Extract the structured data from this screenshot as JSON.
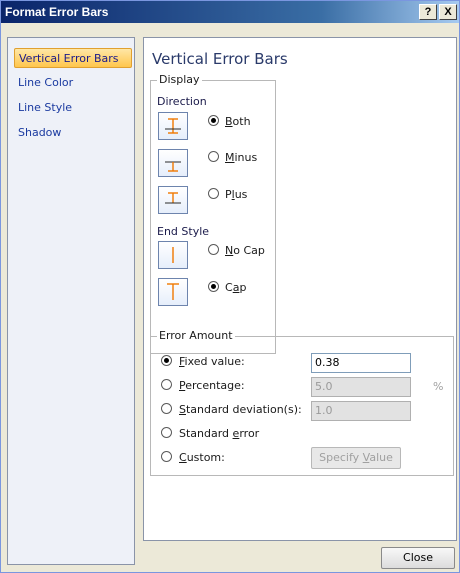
{
  "window": {
    "title": "Format Error Bars",
    "help_label": "?",
    "close_label": "X"
  },
  "nav": {
    "items": [
      {
        "label": "Vertical Error Bars",
        "active": true
      },
      {
        "label": "Line Color",
        "active": false
      },
      {
        "label": "Line Style",
        "active": false
      },
      {
        "label": "Shadow",
        "active": false
      }
    ]
  },
  "panel": {
    "title": "Vertical Error Bars",
    "display": {
      "legend": "Display",
      "direction_label": "Direction",
      "direction_options": [
        {
          "pre": "",
          "ul": "B",
          "post": "oth",
          "checked": true
        },
        {
          "pre": "",
          "ul": "M",
          "post": "inus",
          "checked": false
        },
        {
          "pre": "P",
          "ul": "l",
          "post": "us",
          "checked": false
        }
      ],
      "end_style_label": "End Style",
      "end_style_options": [
        {
          "pre": "",
          "ul": "N",
          "post": "o Cap",
          "checked": false
        },
        {
          "pre": "C",
          "ul": "a",
          "post": "p",
          "checked": true
        }
      ]
    },
    "error_amount": {
      "legend": "Error Amount",
      "options": [
        {
          "pre": "",
          "ul": "F",
          "post": "ixed value:",
          "checked": true
        },
        {
          "pre": "",
          "ul": "P",
          "post": "ercentage:",
          "checked": false
        },
        {
          "pre": "",
          "ul": "S",
          "post": "tandard deviation(s):",
          "checked": false
        },
        {
          "pre": "Standard ",
          "ul": "e",
          "post": "rror",
          "checked": false
        },
        {
          "pre": "",
          "ul": "C",
          "post": "ustom:",
          "checked": false
        }
      ],
      "fixed_value": "0.38",
      "percentage_value": "5.0",
      "percent_sign": "%",
      "std_dev_value": "1.0",
      "specify_pre": "Specify ",
      "specify_ul": "V",
      "specify_post": "alue"
    }
  },
  "footer": {
    "close_label": "Close"
  },
  "colors": {
    "accent_orange": "#f07800",
    "title_bar": "#0a246a",
    "nav_active": "#ffc64d"
  }
}
